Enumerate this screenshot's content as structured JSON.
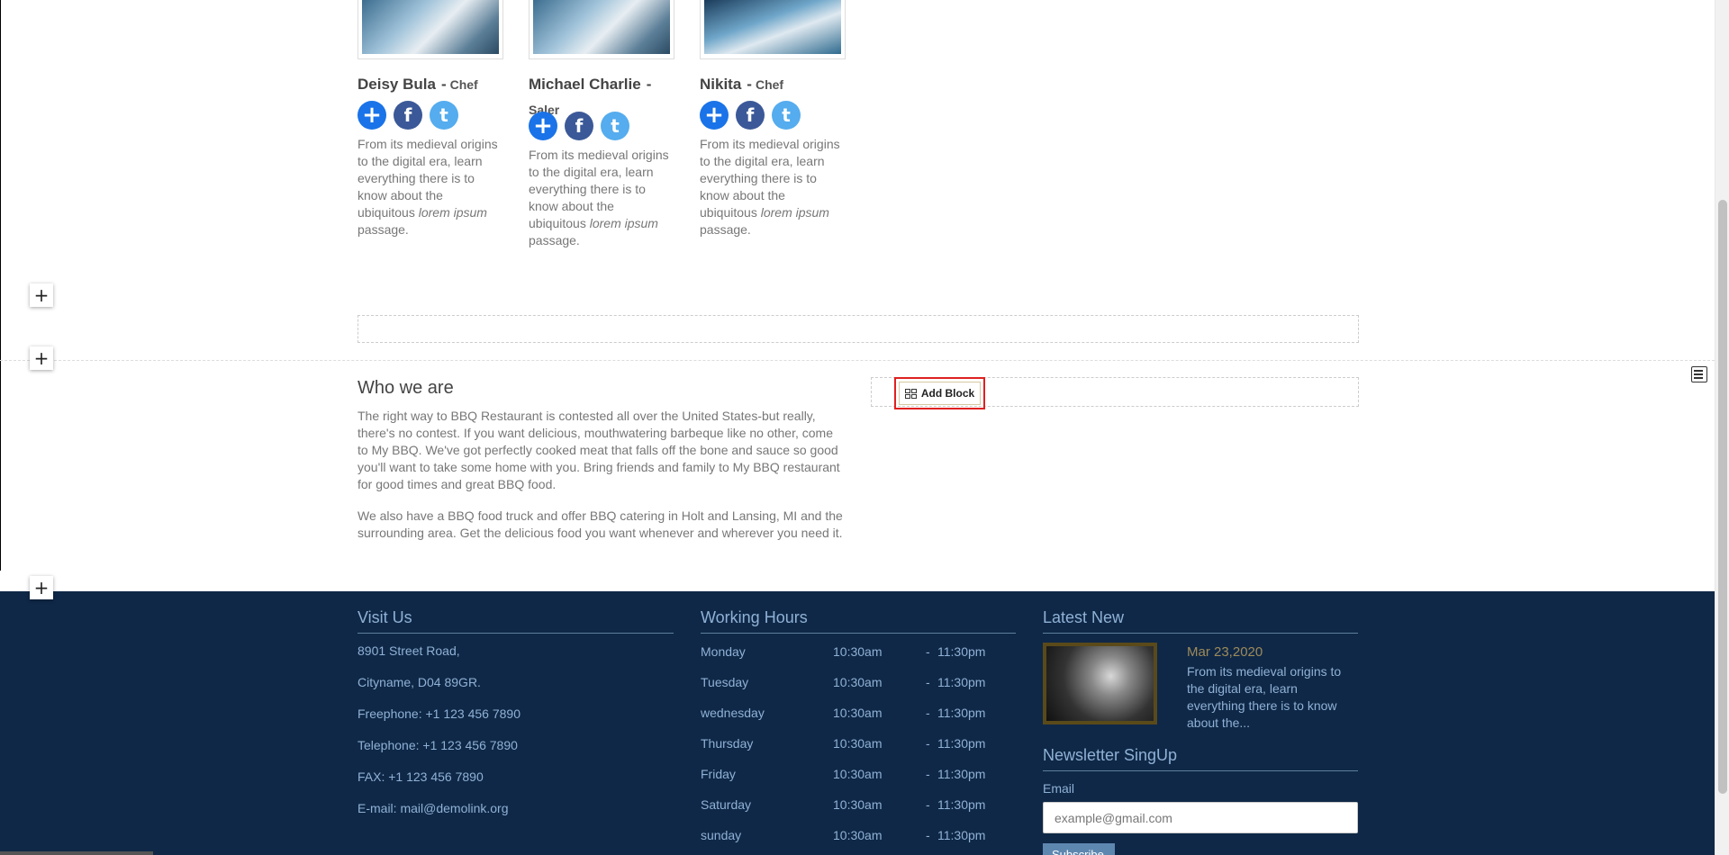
{
  "team": {
    "members": [
      {
        "name": "Deisy Bula",
        "role": "Chef",
        "description_start": "From its medieval origins to the digital era, learn everything there is to know about the ubiquitous ",
        "description_em": "lorem ipsum",
        "description_end": " passage."
      },
      {
        "name": "Michael Charlie",
        "role": "Saler",
        "description_start": "From its medieval origins to the digital era, learn everything there is to know about the ubiquitous ",
        "description_em": "lorem ipsum",
        "description_end": " passage."
      },
      {
        "name": "Nikita",
        "role": "Chef",
        "description_start": "From its medieval origins to the digital era, learn everything there is to know about the ubiquitous ",
        "description_em": "lorem ipsum",
        "description_end": " passage."
      }
    ],
    "dash": "-",
    "icons": {
      "plus": "+",
      "facebook": "f",
      "twitter": "t"
    }
  },
  "builder": {
    "plus_label": "+",
    "add_block_label": "Add Block"
  },
  "about": {
    "title": "Who we are",
    "paragraph1": "The right way to BBQ Restaurant is contested all over the United States-but really, there's no contest. If you want delicious, mouthwatering barbeque like no other, come to My BBQ. We've got perfectly cooked meat that falls off the bone and sauce so good you'll want to take some home with you. Bring friends and family to My BBQ restaurant for good times and great BBQ food.",
    "paragraph2": "We also have a BBQ food truck and offer BBQ catering in Holt and Lansing, MI and the surrounding area. Get the delicious food you want whenever and wherever you need it."
  },
  "footer": {
    "visit": {
      "title": "Visit Us",
      "lines": [
        "8901 Street Road,",
        "Cityname, D04 89GR.",
        "Freephone: +1 123 456 7890",
        "Telephone: +1 123 456 7890",
        "FAX: +1 123 456 7890",
        "E-mail: mail@demolink.org"
      ]
    },
    "hours": {
      "title": "Working Hours",
      "dash": "-",
      "rows": [
        {
          "day": "Monday",
          "open": "10:30am",
          "close": "11:30pm"
        },
        {
          "day": "Tuesday",
          "open": "10:30am",
          "close": "11:30pm"
        },
        {
          "day": "wednesday",
          "open": "10:30am",
          "close": "11:30pm"
        },
        {
          "day": "Thursday",
          "open": "10:30am",
          "close": "11:30pm"
        },
        {
          "day": "Friday",
          "open": "10:30am",
          "close": "11:30pm"
        },
        {
          "day": "Saturday",
          "open": "10:30am",
          "close": "11:30pm"
        },
        {
          "day": "sunday",
          "open": "10:30am",
          "close": "11:30pm"
        }
      ]
    },
    "news": {
      "title": "Latest New",
      "date": "Mar 23,2020",
      "text": "From its medieval origins to the digital era, learn everything there is to know about the..."
    },
    "newsletter": {
      "title": "Newsletter SingUp",
      "email_label": "Email",
      "email_placeholder": "example@gmail.com",
      "subscribe_label": "Subscribe"
    }
  },
  "colors": {
    "footer_bg": "#0f2847",
    "footer_text": "#8fb1d6",
    "accent_blue": "#1a73e8",
    "facebook": "#3b5998",
    "twitter": "#55acee",
    "highlight_red": "#e02020"
  }
}
